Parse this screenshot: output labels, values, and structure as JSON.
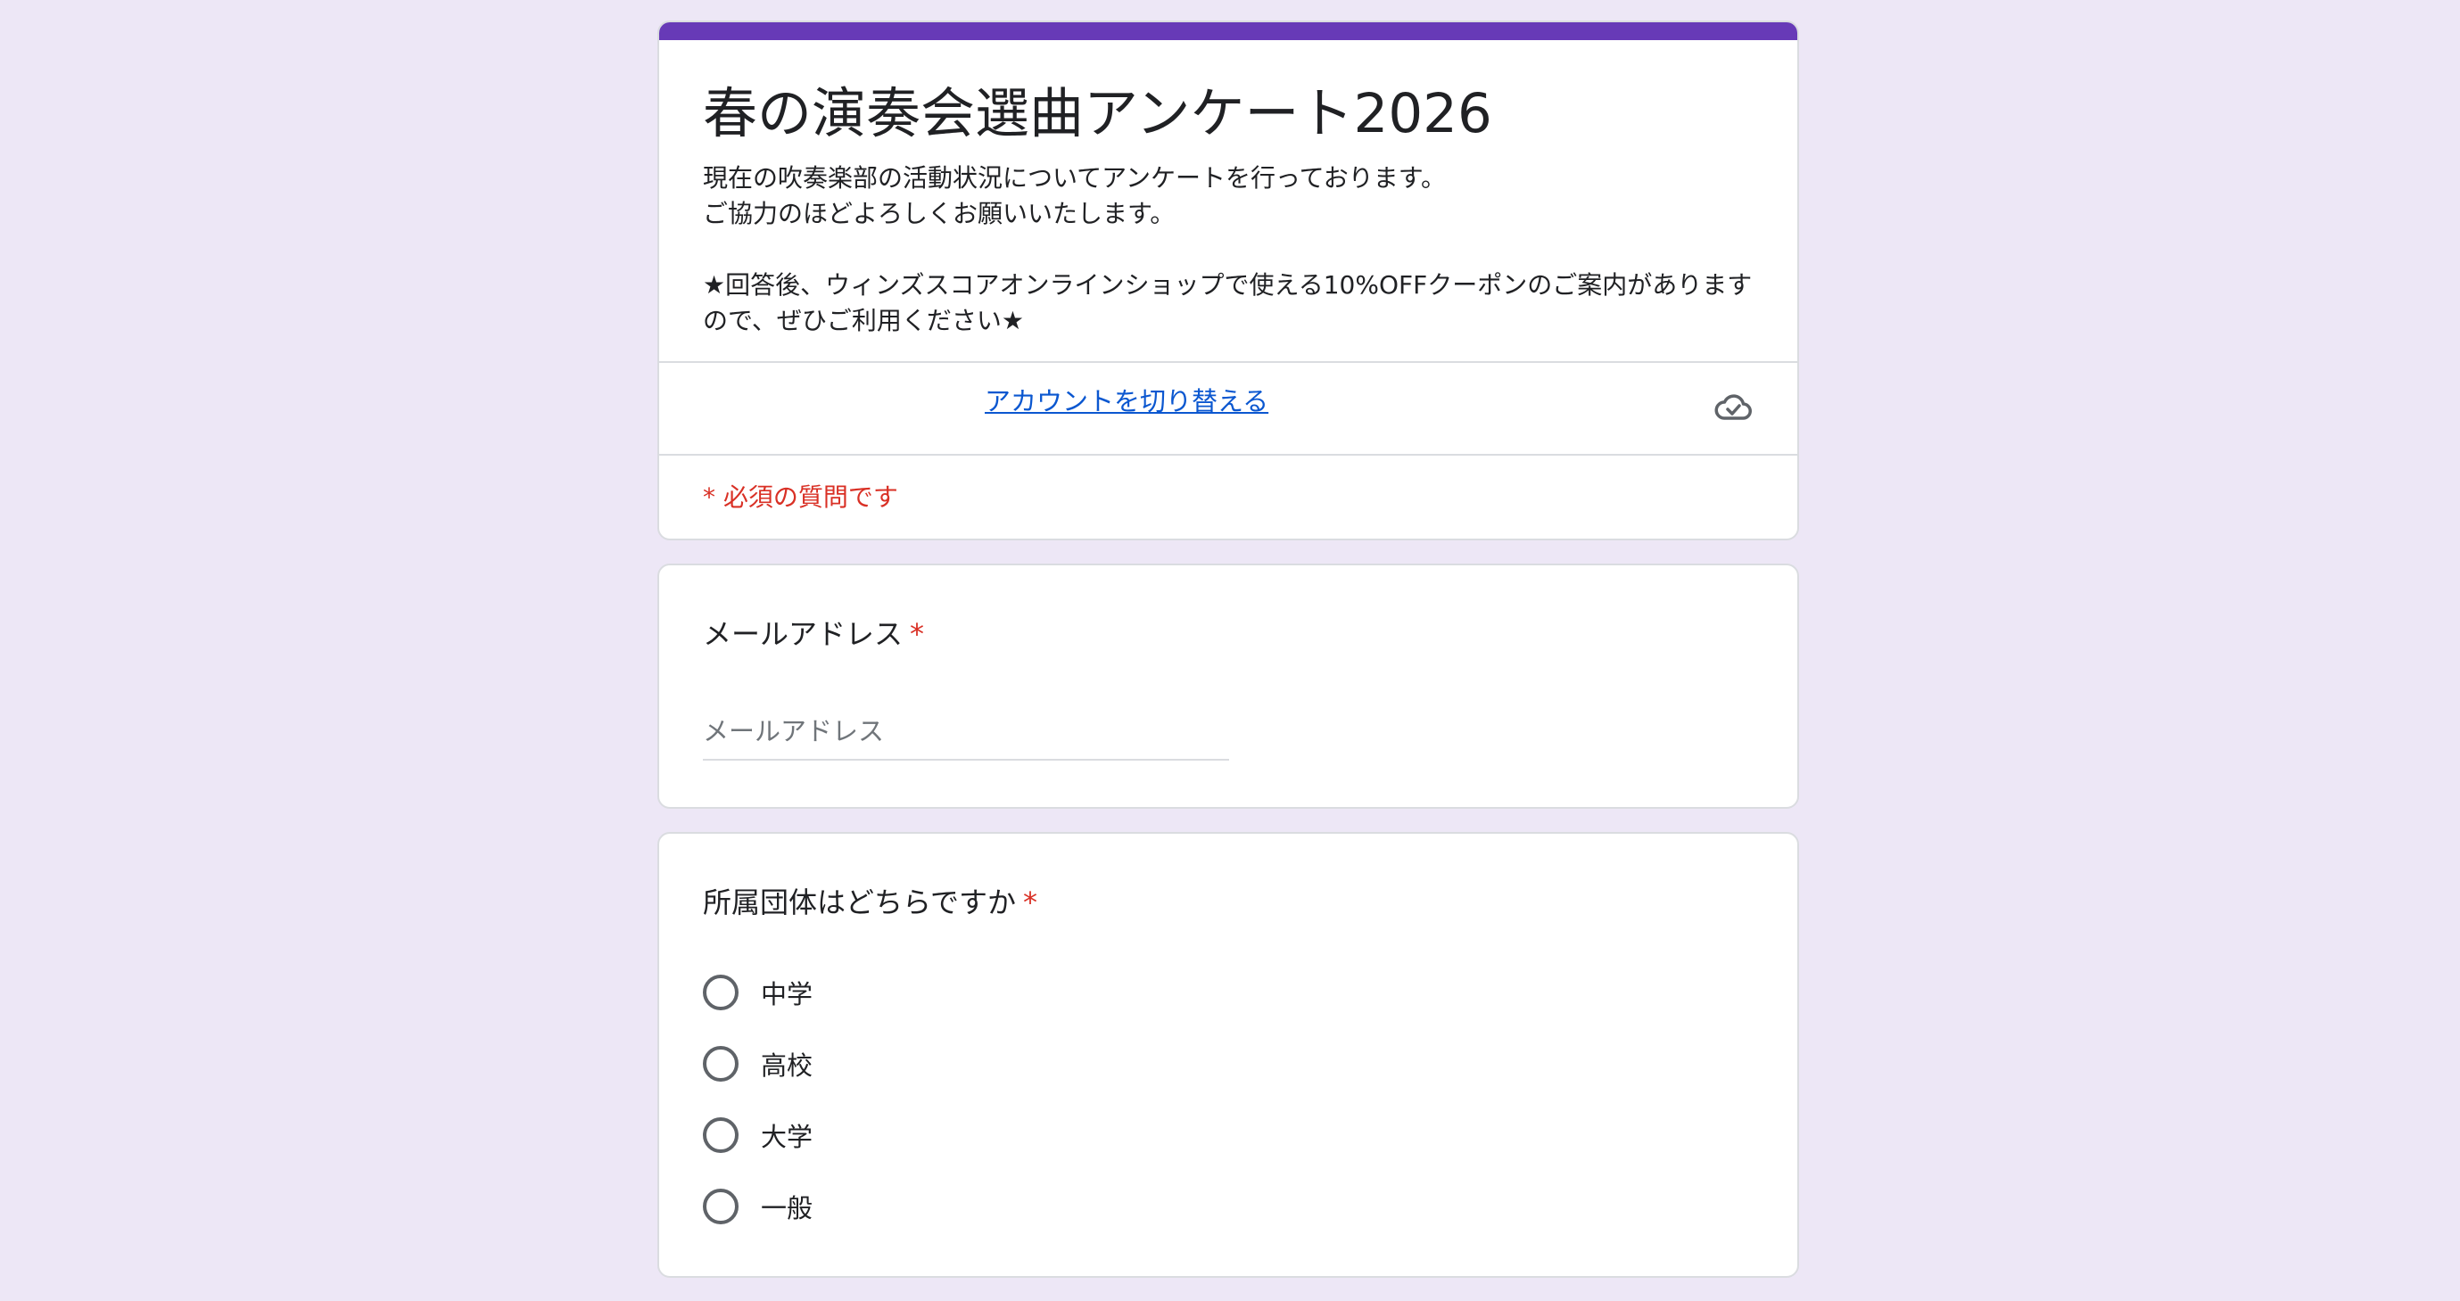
{
  "form": {
    "title": "春の演奏会選曲アンケート2026",
    "description": "現在の吹奏楽部の活動状況についてアンケートを行っております。\nご協力のほどよろしくお願いいたします。\n\n★回答後、ウィンズスコアオンラインショップで使える10%OFFクーポンのご案内がありますので、ぜひご利用ください★",
    "switch_account_label": "アカウントを切り替える",
    "cloud_status_icon": "cloud-check-icon",
    "required_note": "* 必須の質問です"
  },
  "questions": {
    "email": {
      "title": "メールアドレス",
      "required_mark": "*",
      "placeholder": "メールアドレス",
      "value": ""
    },
    "affiliation": {
      "title": "所属団体はどちらですか",
      "required_mark": "*",
      "options": [
        "中学",
        "高校",
        "大学",
        "一般"
      ]
    }
  },
  "colors": {
    "accent": "#673ab7",
    "background": "#ede7f6",
    "required": "#d93025",
    "link": "#0b57d0"
  }
}
